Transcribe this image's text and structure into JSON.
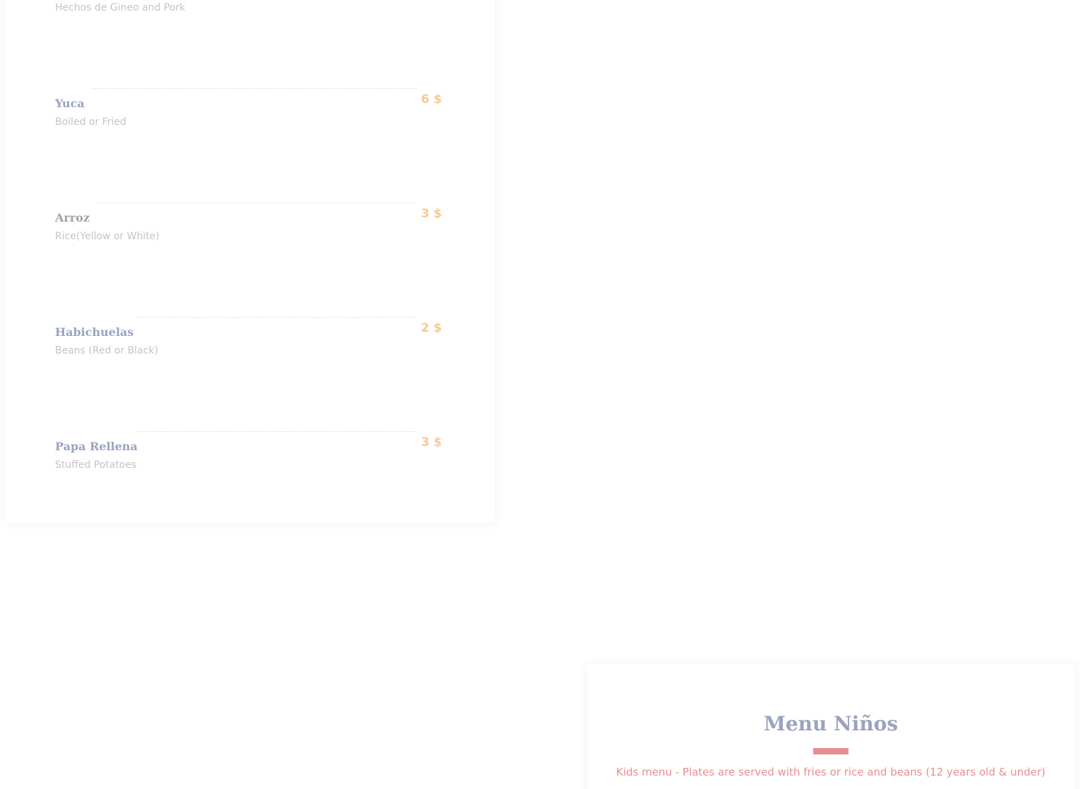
{
  "sides_menu": {
    "first_desc": "Hechos de Gineo and Pork",
    "items": [
      {
        "title": "Yuca",
        "desc": "Boiled or Fried",
        "price": "6 $"
      },
      {
        "title": "Arroz",
        "desc": "Rice(Yellow or White)",
        "price": "3 $"
      },
      {
        "title": "Habichuelas",
        "desc": "Beans (Red or Black)",
        "price": "2 $"
      },
      {
        "title": "Papa Rellena",
        "desc": "Stuffed Potatoes",
        "price": "3 $"
      }
    ]
  },
  "kids_menu": {
    "title": "Menu Niños",
    "subtitle": "Kids menu - Plates are served  with fries or rice and beans (12 years old & under)"
  },
  "colors": {
    "title": "#9aa3bf",
    "price": "#f7c993",
    "description": "#c4c4c4",
    "accent": "#e98d8f"
  }
}
